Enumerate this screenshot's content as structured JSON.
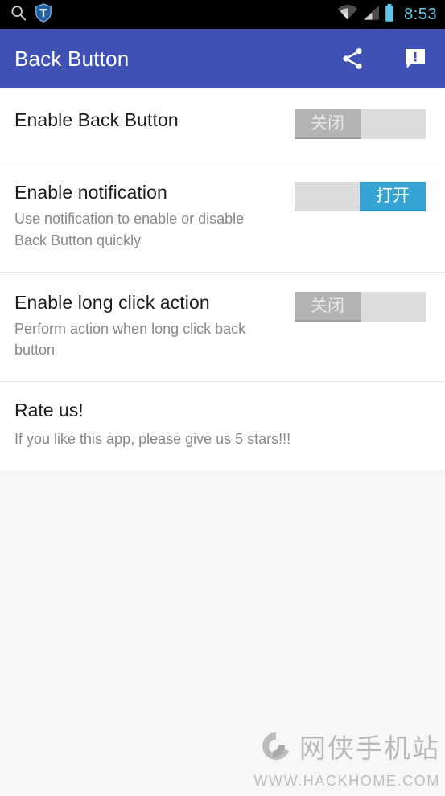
{
  "statusbar": {
    "icons_left": [
      "search-icon",
      "shield-icon"
    ],
    "icons_right": [
      "wifi-icon",
      "cell-signal-icon",
      "battery-icon"
    ],
    "clock": "8:53",
    "clock_color": "#64c8e6",
    "background": "#000000"
  },
  "actionbar": {
    "title": "Back Button",
    "background": "#3f51b5",
    "actions": [
      {
        "name": "share-icon",
        "label": "Share"
      },
      {
        "name": "feedback-icon",
        "label": "Feedback"
      }
    ]
  },
  "settings": {
    "rows": [
      {
        "title": "Enable Back Button",
        "summary": "",
        "switch": {
          "state": "off",
          "label": "关闭"
        }
      },
      {
        "title": "Enable notification",
        "summary": "Use notification to enable or disable Back Button quickly",
        "switch": {
          "state": "on",
          "label": "打开"
        }
      },
      {
        "title": "Enable long click action",
        "summary": "Perform action when long click back button",
        "switch": {
          "state": "off",
          "label": "关闭"
        }
      }
    ],
    "rate": {
      "title": "Rate us!",
      "summary": "If you like this app, please give us 5 stars!!!"
    }
  },
  "colors": {
    "accent_on": "#35a4d4",
    "switch_off_thumb": "#b3b3b3",
    "switch_track": "#dcdcdc",
    "primary": "#3f51b5",
    "page_background": "#f7f7f7"
  },
  "watermark": {
    "site_cn": "网侠手机站",
    "url": "WWW.HACKHOME.COM"
  }
}
